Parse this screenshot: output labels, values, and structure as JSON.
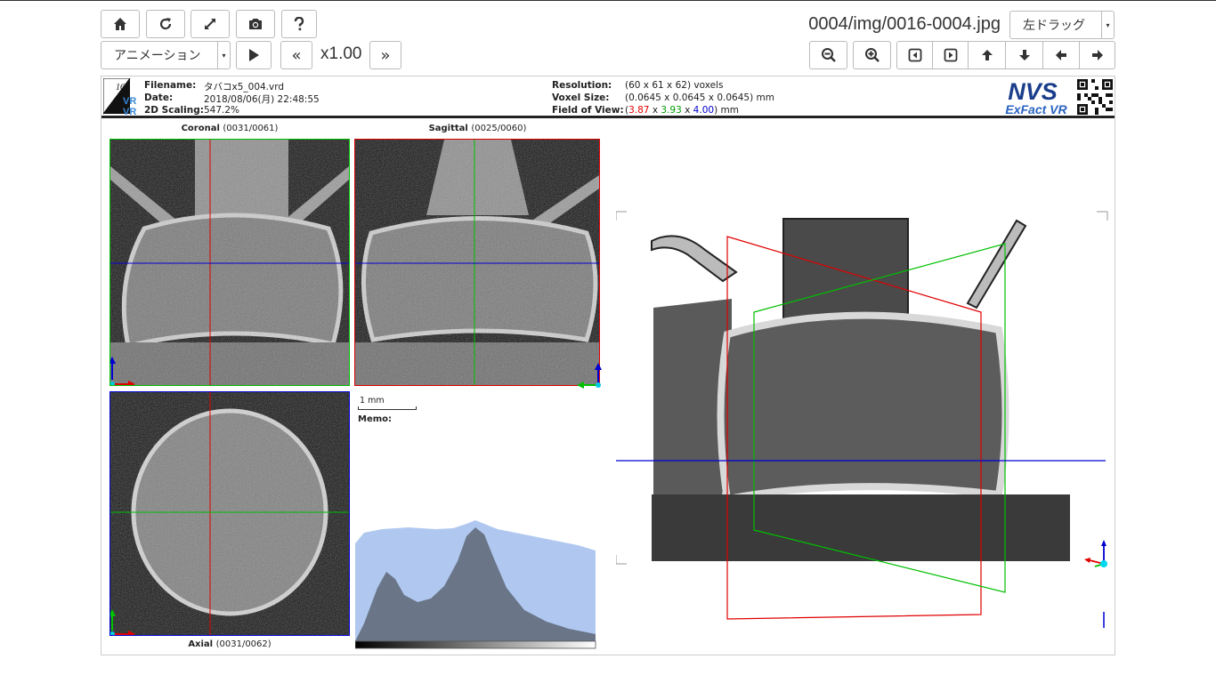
{
  "toolbar": {
    "speed": "x1.00",
    "animation_select": "アニメーション",
    "image_path": "0004/img/0016-0004.jpg",
    "drag_select": "左ドラッグ"
  },
  "info": {
    "badge_top": "16",
    "badge_bottom": "4",
    "filename_label": "Filename:",
    "filename": "タバコx5_004.vrd",
    "date_label": "Date:",
    "date": "2018/08/06(月) 22:48:55",
    "scaling_label": "2D Scaling:",
    "scaling": "547.2%",
    "resolution_label": "Resolution:",
    "resolution": "(60 x 61 x 62) voxels",
    "voxel_label": "Voxel Size:",
    "voxel": "(0.0645 x 0.0645 x 0.0645) mm",
    "fov_label": "Field of View:",
    "fov_open": "(",
    "fov_x": "3.87",
    "fov_sep1": " x ",
    "fov_y": "3.93",
    "fov_sep2": " x ",
    "fov_z": "4.00",
    "fov_close": ") mm",
    "logo_top": "NVS",
    "logo_bottom": "ExFact VR"
  },
  "panels": {
    "coronal_name": "Coronal",
    "coronal_idx": "(0031/0061)",
    "sagittal_name": "Sagittal",
    "sagittal_idx": "(0025/0060)",
    "axial_name": "Axial",
    "axial_idx": "(0031/0062)",
    "scale": "1 mm",
    "memo": "Memo:"
  },
  "colors": {
    "accent_red": "#e00000",
    "accent_green": "#00b000",
    "accent_blue": "#0000d0"
  }
}
